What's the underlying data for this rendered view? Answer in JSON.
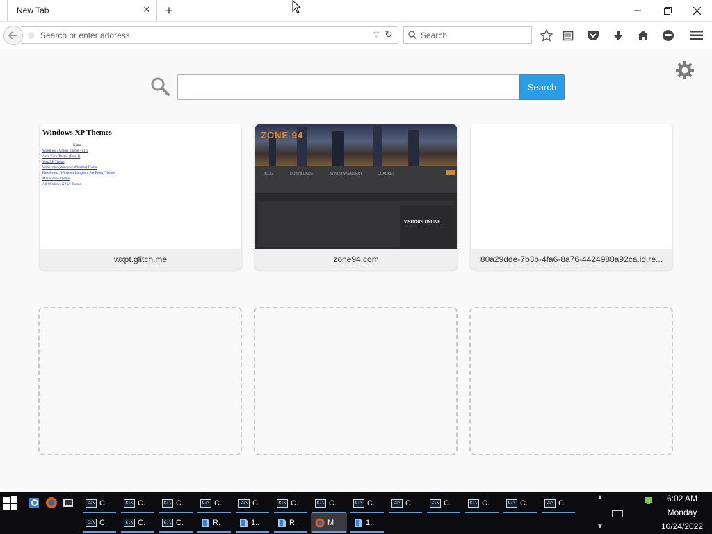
{
  "browser": {
    "tab_title": "New Tab",
    "url_placeholder": "Search or enter address",
    "search_placeholder": "Search"
  },
  "page": {
    "search_button": "Search",
    "tiles": [
      {
        "label": "wxpt.glitch.me"
      },
      {
        "label": "zone94.com"
      },
      {
        "label": "80a29dde-7b3b-4fa6-8a76-4424980a92ca.id.re..."
      }
    ],
    "thumb_xp": {
      "title": "Windows XP Themes",
      "name_header": "Name",
      "links": [
        "Windows 7 Colors Theme - v1.1",
        "Aero View Theme (Beta 1)",
        "VistaXP Theme",
        "Watercolor (Windows Whistler) Theme",
        "Plex Remix (Windows Longhorn Pre-Reset) Theme",
        "Mario Zune Theme",
        "All Windows XP UI Theme"
      ]
    },
    "thumb_zone94": {
      "logo": "ZONE 94",
      "nav": [
        "BLOG",
        "DOWNLOADS",
        "WINDOW GALLERY",
        "QUADRET"
      ],
      "visitors": "VISITORS ONLINE"
    }
  },
  "taskbar": {
    "row1": [
      "C.",
      "C.",
      "C.",
      "C.",
      "C.",
      "C.",
      "C.",
      "C.",
      "C.",
      "C.",
      "C.",
      "C.",
      "C."
    ],
    "row2": [
      {
        "label": "C.",
        "kind": "cmd"
      },
      {
        "label": "C.",
        "kind": "cmd"
      },
      {
        "label": "C.",
        "kind": "cmd"
      },
      {
        "label": "R.",
        "kind": "doc"
      },
      {
        "label": "1..",
        "kind": "doc"
      },
      {
        "label": "R.",
        "kind": "doc"
      },
      {
        "label": "M",
        "kind": "firefox"
      },
      {
        "label": "1..",
        "kind": "doc"
      }
    ],
    "clock": {
      "time": "6:02 AM",
      "day": "Monday",
      "date": "10/24/2022"
    }
  }
}
